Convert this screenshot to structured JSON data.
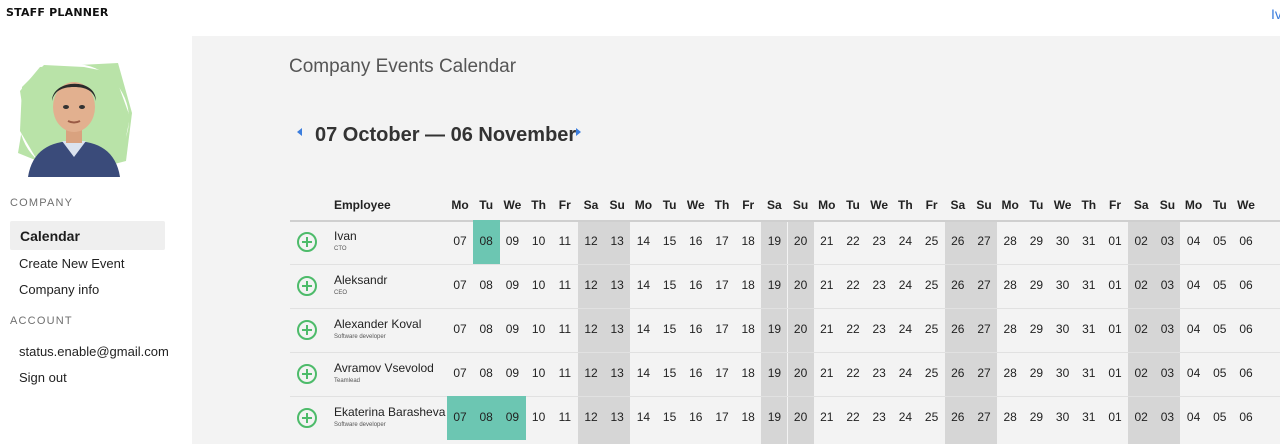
{
  "app": {
    "brand": "STAFF PLANNER",
    "user_initial": "Iv"
  },
  "sidebar": {
    "avatar_icon": "user-avatar-icon",
    "company_title": "COMPANY",
    "company_items": [
      "Calendar",
      "Create New Event",
      "Company info"
    ],
    "active_item": "Calendar",
    "account_title": "ACCOUNT",
    "account_items": [
      "status.enable@gmail.com",
      "Sign out"
    ]
  },
  "main": {
    "title": "Company Events Calendar",
    "range": "07 October — 06 November",
    "prev_icon": "chevron-left-icon",
    "next_icon": "chevron-right-icon"
  },
  "calendar": {
    "employee_header": "Employee",
    "days": [
      {
        "dow": "Mo",
        "num": "07",
        "weekend": false
      },
      {
        "dow": "Tu",
        "num": "08",
        "weekend": false
      },
      {
        "dow": "We",
        "num": "09",
        "weekend": false
      },
      {
        "dow": "Th",
        "num": "10",
        "weekend": false
      },
      {
        "dow": "Fr",
        "num": "11",
        "weekend": false
      },
      {
        "dow": "Sa",
        "num": "12",
        "weekend": true
      },
      {
        "dow": "Su",
        "num": "13",
        "weekend": true
      },
      {
        "dow": "Mo",
        "num": "14",
        "weekend": false
      },
      {
        "dow": "Tu",
        "num": "15",
        "weekend": false
      },
      {
        "dow": "We",
        "num": "16",
        "weekend": false
      },
      {
        "dow": "Th",
        "num": "17",
        "weekend": false
      },
      {
        "dow": "Fr",
        "num": "18",
        "weekend": false
      },
      {
        "dow": "Sa",
        "num": "19",
        "weekend": true
      },
      {
        "dow": "Su",
        "num": "20",
        "weekend": true
      },
      {
        "dow": "Mo",
        "num": "21",
        "weekend": false
      },
      {
        "dow": "Tu",
        "num": "22",
        "weekend": false
      },
      {
        "dow": "We",
        "num": "23",
        "weekend": false
      },
      {
        "dow": "Th",
        "num": "24",
        "weekend": false
      },
      {
        "dow": "Fr",
        "num": "25",
        "weekend": false
      },
      {
        "dow": "Sa",
        "num": "26",
        "weekend": true
      },
      {
        "dow": "Su",
        "num": "27",
        "weekend": true
      },
      {
        "dow": "Mo",
        "num": "28",
        "weekend": false
      },
      {
        "dow": "Tu",
        "num": "29",
        "weekend": false
      },
      {
        "dow": "We",
        "num": "30",
        "weekend": false
      },
      {
        "dow": "Th",
        "num": "31",
        "weekend": false
      },
      {
        "dow": "Fr",
        "num": "01",
        "weekend": false
      },
      {
        "dow": "Sa",
        "num": "02",
        "weekend": true
      },
      {
        "dow": "Su",
        "num": "03",
        "weekend": true
      },
      {
        "dow": "Mo",
        "num": "04",
        "weekend": false
      },
      {
        "dow": "Tu",
        "num": "05",
        "weekend": false
      },
      {
        "dow": "We",
        "num": "06",
        "weekend": false
      }
    ],
    "employees": [
      {
        "name": "Ivan",
        "role": "CTO",
        "events": [
          1
        ]
      },
      {
        "name": "Aleksandr",
        "role": "CEO",
        "events": []
      },
      {
        "name": "Alexander Koval",
        "role": "Software developer",
        "events": []
      },
      {
        "name": "Avramov Vsevolod",
        "role": "Teamlead",
        "events": []
      },
      {
        "name": "Ekaterina Barasheva",
        "role": "Software developer",
        "events": [
          0,
          1,
          2
        ]
      }
    ],
    "add_icon": "plus-circle-icon",
    "colors": {
      "weekend": "#d6d6d6",
      "event": "#6cc6b2",
      "add": "#4dbb6a",
      "link": "#3b7ddd"
    }
  }
}
